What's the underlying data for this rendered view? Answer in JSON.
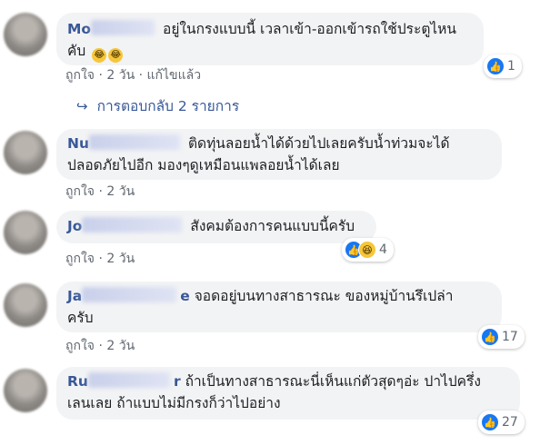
{
  "comments": [
    {
      "name": "Mo",
      "text_line1": "อยู่ในกรงแบบนี้ เวลาเข้า-ออกเข้ารถใช้ประตูไหน",
      "text_line2": "คับ",
      "like_label": "ถูกใจ",
      "time": "2 วัน",
      "edited": "แก้ไขแล้ว",
      "reaction_count": "1"
    },
    {
      "name": "Nu",
      "text_line1": "ติดทุ่นลอยน้ำได้ด้วยไปเลยครับน้ำท่วมจะได้",
      "text_line2": "ปลอดภัยไปอีก มองๆดูเหมือนแพลอยน้ำได้เลย",
      "like_label": "ถูกใจ",
      "time": "2 วัน"
    },
    {
      "name": "Jo",
      "text_line1": "สังคมต้องการคนแบบนี้ครับ",
      "like_label": "ถูกใจ",
      "time": "2 วัน",
      "reaction_count": "4"
    },
    {
      "name": "Ja",
      "name_tail": "e",
      "text_line1": "จอดอยู่บนทางสาธารณะ ของหมู่บ้านรึเปล่า",
      "text_line2": "ครับ",
      "like_label": "ถูกใจ",
      "time": "2 วัน",
      "reaction_count": "17"
    },
    {
      "name": "Ru",
      "name_tail": "r",
      "text_line1": "ถ้าเป็นทางสาธารณะนี่เห็นแก่ตัวสุดๆอ่ะ ปาไปครึ่ง",
      "text_line2": "เลนเลย ถ้าแบบไม่มีกรงก็ว่าไปอย่าง",
      "like_label": "ถูกใจ",
      "time": "2 วัน",
      "reaction_count": "27"
    }
  ],
  "replies_link": "การตอบกลับ 2 รายการ",
  "separator": "·",
  "icons": {
    "like": "thumbs-up-icon",
    "haha": "laughing-face-icon",
    "reply_arrow": "reply-arrow-icon"
  },
  "colors": {
    "link": "#385898",
    "bubble": "#f2f3f5",
    "like_blue": "#1877f2",
    "meta": "#606770"
  }
}
